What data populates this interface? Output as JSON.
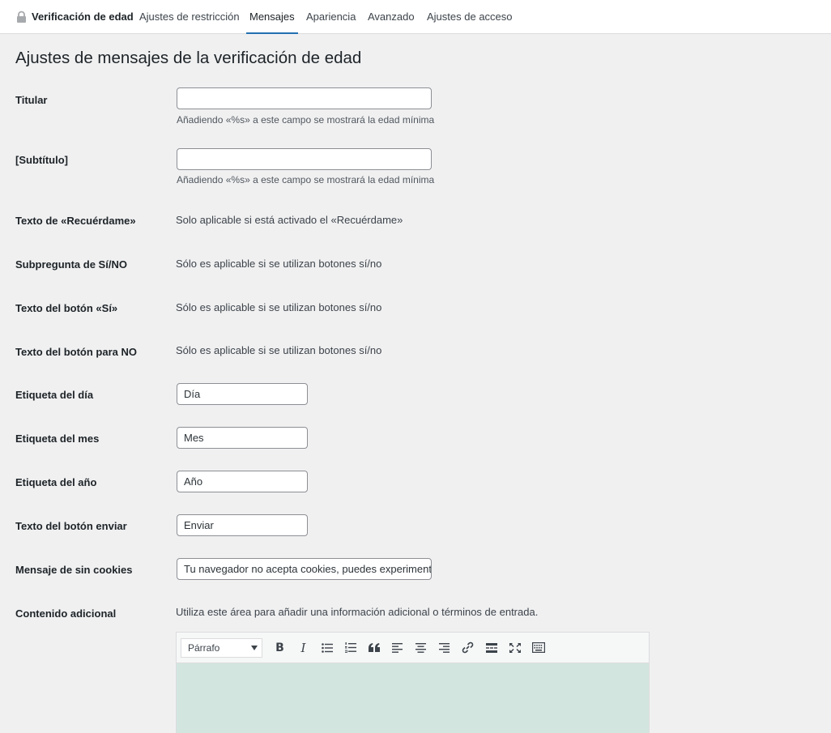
{
  "nav": {
    "brand": "Verificación de edad",
    "tabs": [
      {
        "label": "Ajustes de restricción"
      },
      {
        "label": "Mensajes"
      },
      {
        "label": "Apariencia"
      },
      {
        "label": "Avanzado"
      },
      {
        "label": "Ajustes de acceso"
      }
    ],
    "active_tab": "Mensajes"
  },
  "page_title": "Ajustes de mensajes de la verificación de edad",
  "fields": {
    "headline": {
      "label": "Titular",
      "value": "",
      "description": "Añadiendo «%s» a este campo se mostrará la edad mínima"
    },
    "subtitle": {
      "label": "[Subtítulo]",
      "value": "",
      "description": "Añadiendo «%s» a este campo se mostrará la edad mínima"
    },
    "remember_text": {
      "label": "Texto de «Recuérdame»",
      "note": "Solo aplicable si está activado el «Recuérdame»"
    },
    "yes_no_subquestion": {
      "label": "Subpregunta de Sí/NO",
      "note": "Sólo es aplicable si se utilizan botones sí/no"
    },
    "yes_button_text": {
      "label": "Texto del botón «Sí»",
      "note": "Sólo es aplicable si se utilizan botones sí/no"
    },
    "no_button_text": {
      "label": "Texto del botón para NO",
      "note": "Sólo es aplicable si se utilizan botones sí/no"
    },
    "day_label": {
      "label": "Etiqueta del día",
      "value": "Día"
    },
    "month_label": {
      "label": "Etiqueta del mes",
      "value": "Mes"
    },
    "year_label": {
      "label": "Etiqueta del año",
      "value": "Año"
    },
    "submit_button_text": {
      "label": "Texto del botón enviar",
      "value": "Enviar"
    },
    "no_cookies_message": {
      "label": "Mensaje de sin cookies",
      "value": "Tu navegador no acepta cookies, puedes experimenta"
    },
    "additional_content": {
      "label": "Contenido adicional",
      "note": "Utiliza este área para añadir una información adicional o términos de entrada."
    }
  },
  "editor": {
    "format_value": "Párrafo",
    "tools": [
      {
        "name": "bold-icon",
        "glyph": "B"
      },
      {
        "name": "italic-icon",
        "glyph": "I"
      },
      {
        "name": "bulleted-list-icon",
        "glyph": "list"
      },
      {
        "name": "numbered-list-icon",
        "glyph": "olist"
      },
      {
        "name": "blockquote-icon",
        "glyph": "quote"
      },
      {
        "name": "align-left-icon",
        "glyph": "left"
      },
      {
        "name": "align-center-icon",
        "glyph": "center"
      },
      {
        "name": "align-right-icon",
        "glyph": "right"
      },
      {
        "name": "link-icon",
        "glyph": "link"
      },
      {
        "name": "read-more-icon",
        "glyph": "more"
      },
      {
        "name": "fullscreen-icon",
        "glyph": "full"
      },
      {
        "name": "toolbar-toggle-icon",
        "glyph": "kbd"
      }
    ],
    "body_color": "#d2e6df"
  },
  "colors": {
    "accent": "#2271b1",
    "background": "#f0f0f1"
  }
}
